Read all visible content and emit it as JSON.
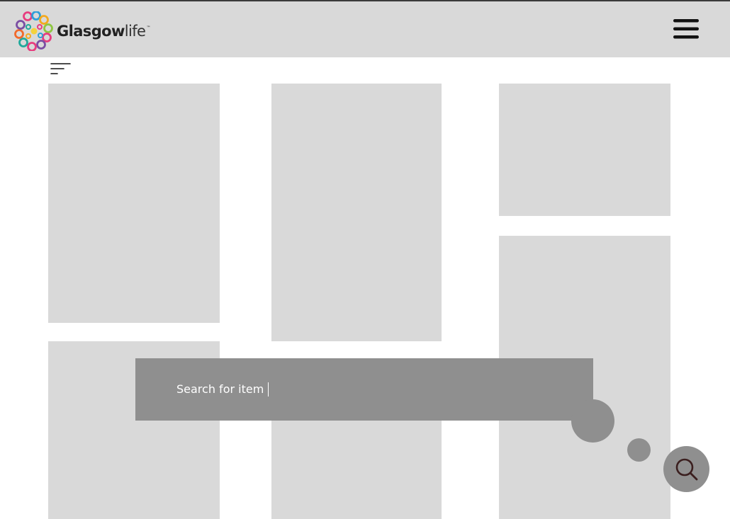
{
  "header": {
    "brand_bold": "Glasgow",
    "brand_light": "life",
    "brand_tm": "™",
    "logo_icon": "glasgow-life-flower-logo",
    "menu_icon": "hamburger-menu-icon"
  },
  "toolbar": {
    "filter_icon": "filter-sort-lines-icon"
  },
  "grid": {
    "tile_color": "#d9d9d9",
    "tile_count": 8
  },
  "search": {
    "value": "Search for item",
    "has_caret": true,
    "background": "#8f8f8f",
    "fab_icon": "search-icon"
  },
  "colors": {
    "header_bg": "#d9d9d9",
    "page_bg": "#ffffff",
    "accent_gray": "#8f8f8f",
    "icon_dark": "#111111",
    "search_icon_color": "#3b1f1f"
  }
}
